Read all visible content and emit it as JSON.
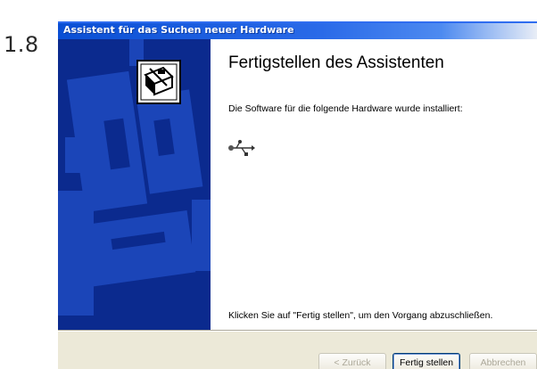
{
  "step_number": "1.8",
  "window": {
    "title": "Assistent für das Suchen neuer Hardware"
  },
  "content": {
    "heading": "Fertigstellen des Assistenten",
    "intro": "Die Software für die folgende Hardware wurde installiert:",
    "device_icon": "usb-icon",
    "finish_hint": "Klicken Sie auf \"Fertig stellen\", um den Vorgang abzuschließen."
  },
  "buttons": {
    "back": "< Zurück",
    "finish": "Fertig stellen",
    "cancel": "Abbrechen"
  },
  "colors": {
    "titlebar": "#0a4fd4",
    "side_panel": "#0b2a8e",
    "dialog_face": "#ece9d8"
  }
}
